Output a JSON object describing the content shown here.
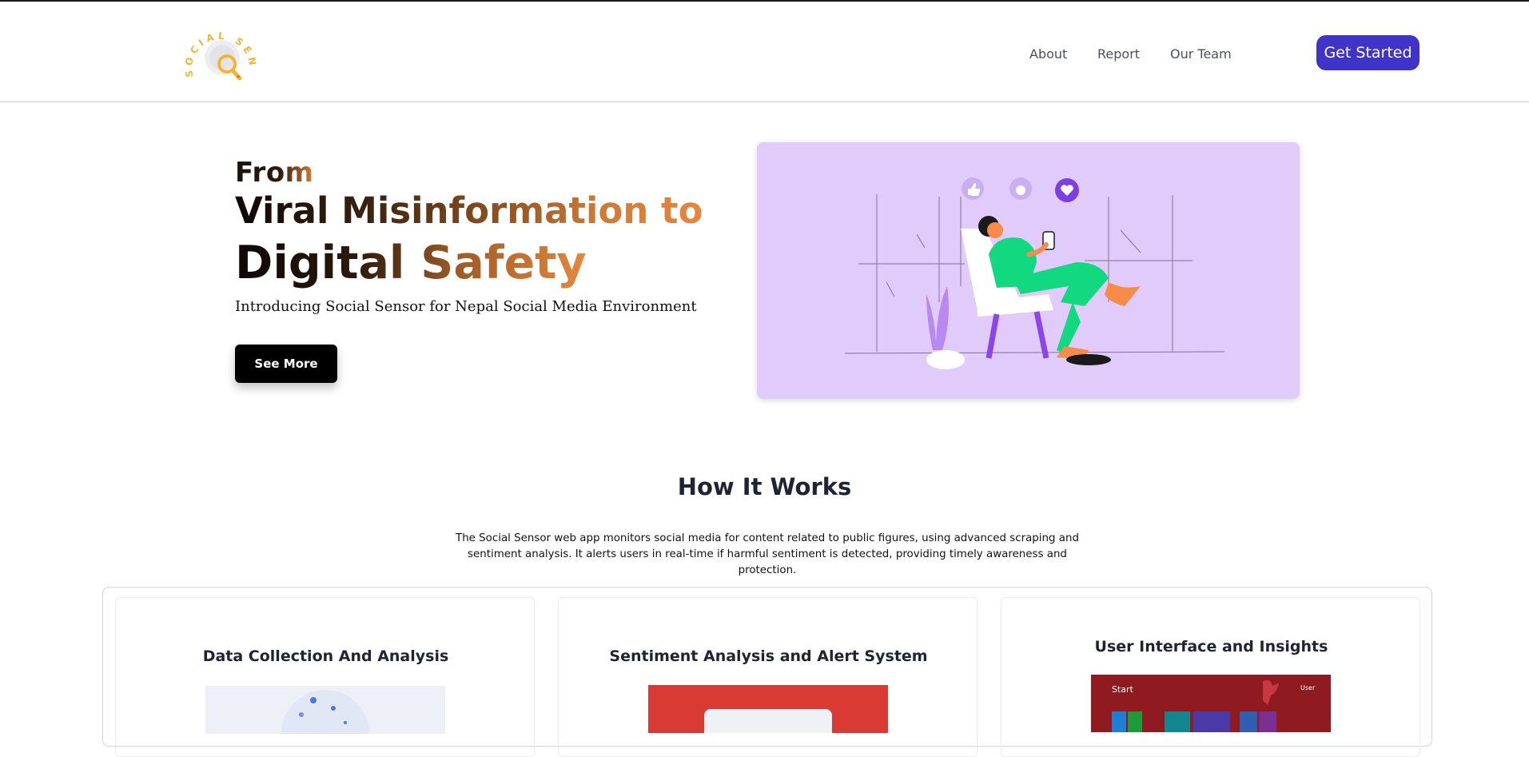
{
  "header": {
    "logo_text": "SOCIAL SENSOR",
    "nav": [
      {
        "label": "About"
      },
      {
        "label": "Report"
      },
      {
        "label": "Our Team"
      }
    ],
    "cta_label": "Get Started"
  },
  "hero": {
    "line_from": "From",
    "line_1": "Viral Misinformation to",
    "line_2": "Digital Safety",
    "subtitle": "Introducing Social Sensor for Nepal Social Media Environment",
    "button_label": "See More"
  },
  "how_it_works": {
    "title": "How It Works",
    "description": "The Social Sensor web app monitors social media for content related to public figures, using advanced scraping and sentiment analysis. It alerts users in real-time if harmful sentiment is detected, providing timely awareness and protection.",
    "cards": [
      {
        "title": "Data Collection And Analysis"
      },
      {
        "title": "Sentiment Analysis and Alert System"
      },
      {
        "title": "User Interface and Insights",
        "screen_label_start": "Start",
        "screen_label_user": "User"
      }
    ]
  },
  "colors": {
    "accent": "#4033c7",
    "hero_card_bg": "#e1cbfb",
    "logo_yellow": "#f2b632",
    "gradient_end": "#e8873c"
  }
}
